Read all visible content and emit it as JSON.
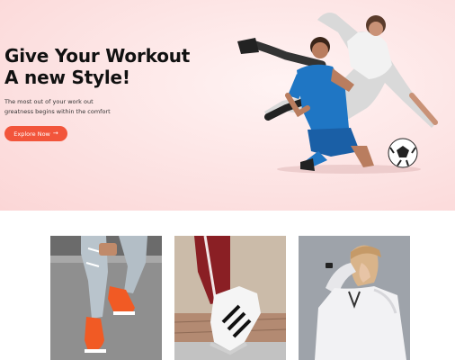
{
  "theme": {
    "accent": "#f2553b",
    "hero_bg": "#fde6e6",
    "title_color": "#111111"
  },
  "hero": {
    "title_line1": "Give Your Workout",
    "title_line2": "A new Style!",
    "subtitle_line1": "The most out of your work out",
    "subtitle_line2": "greatness begins within the comfort",
    "cta_label": "Explore Now",
    "cta_icon": "arrow-right-icon",
    "image": "soccer-players-kicking-ball-photo"
  },
  "cards": [
    {
      "image": "ripped-jeans-orange-sneakers-photo"
    },
    {
      "image": "striped-pants-white-sneakers-photo"
    },
    {
      "image": "woman-white-hoodie-smartwatch-photo"
    }
  ]
}
